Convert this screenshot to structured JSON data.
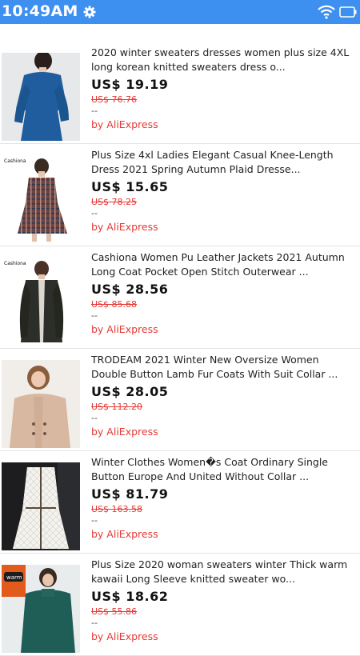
{
  "status_bar": {
    "time": "10:49AM"
  },
  "products": [
    {
      "title": "2020 winter sweaters dresses women plus size 4XL long korean knitted sweaters dress o...",
      "price": "US$ 19.19",
      "original_price": "US$ 76.76",
      "extra": "--",
      "store": "by AliExpress"
    },
    {
      "title": "Plus Size 4xl Ladies Elegant Casual Knee-Length Dress 2021 Spring Autumn Plaid Dresse...",
      "price": "US$ 15.65",
      "original_price": "US$ 78.25",
      "extra": "--",
      "store": "by AliExpress",
      "image_label": "Cashiona"
    },
    {
      "title": "Cashiona Women Pu Leather Jackets 2021 Autumn Long Coat Pocket Open Stitch Outerwear ...",
      "price": "US$ 28.56",
      "original_price": "US$ 85.68",
      "extra": "--",
      "store": "by AliExpress",
      "image_label": "Cashiona"
    },
    {
      "title": "TRODEAM 2021 Winter New Oversize Women Double Button Lamb Fur Coats With Suit Collar ...",
      "price": "US$ 28.05",
      "original_price": "US$ 112.20",
      "extra": "--",
      "store": "by AliExpress"
    },
    {
      "title": "Winter Clothes Women�s Coat Ordinary Single Button Europe And United Without Collar ...",
      "price": "US$ 81.79",
      "original_price": "US$ 163.58",
      "extra": "--",
      "store": "by AliExpress"
    },
    {
      "title": "Plus Size 2020 woman sweaters winter Thick warm kawaii Long Sleeve knitted sweater wo...",
      "price": "US$ 18.62",
      "original_price": "US$ 55.86",
      "extra": "--",
      "store": "by AliExpress",
      "image_label": "warm"
    }
  ]
}
